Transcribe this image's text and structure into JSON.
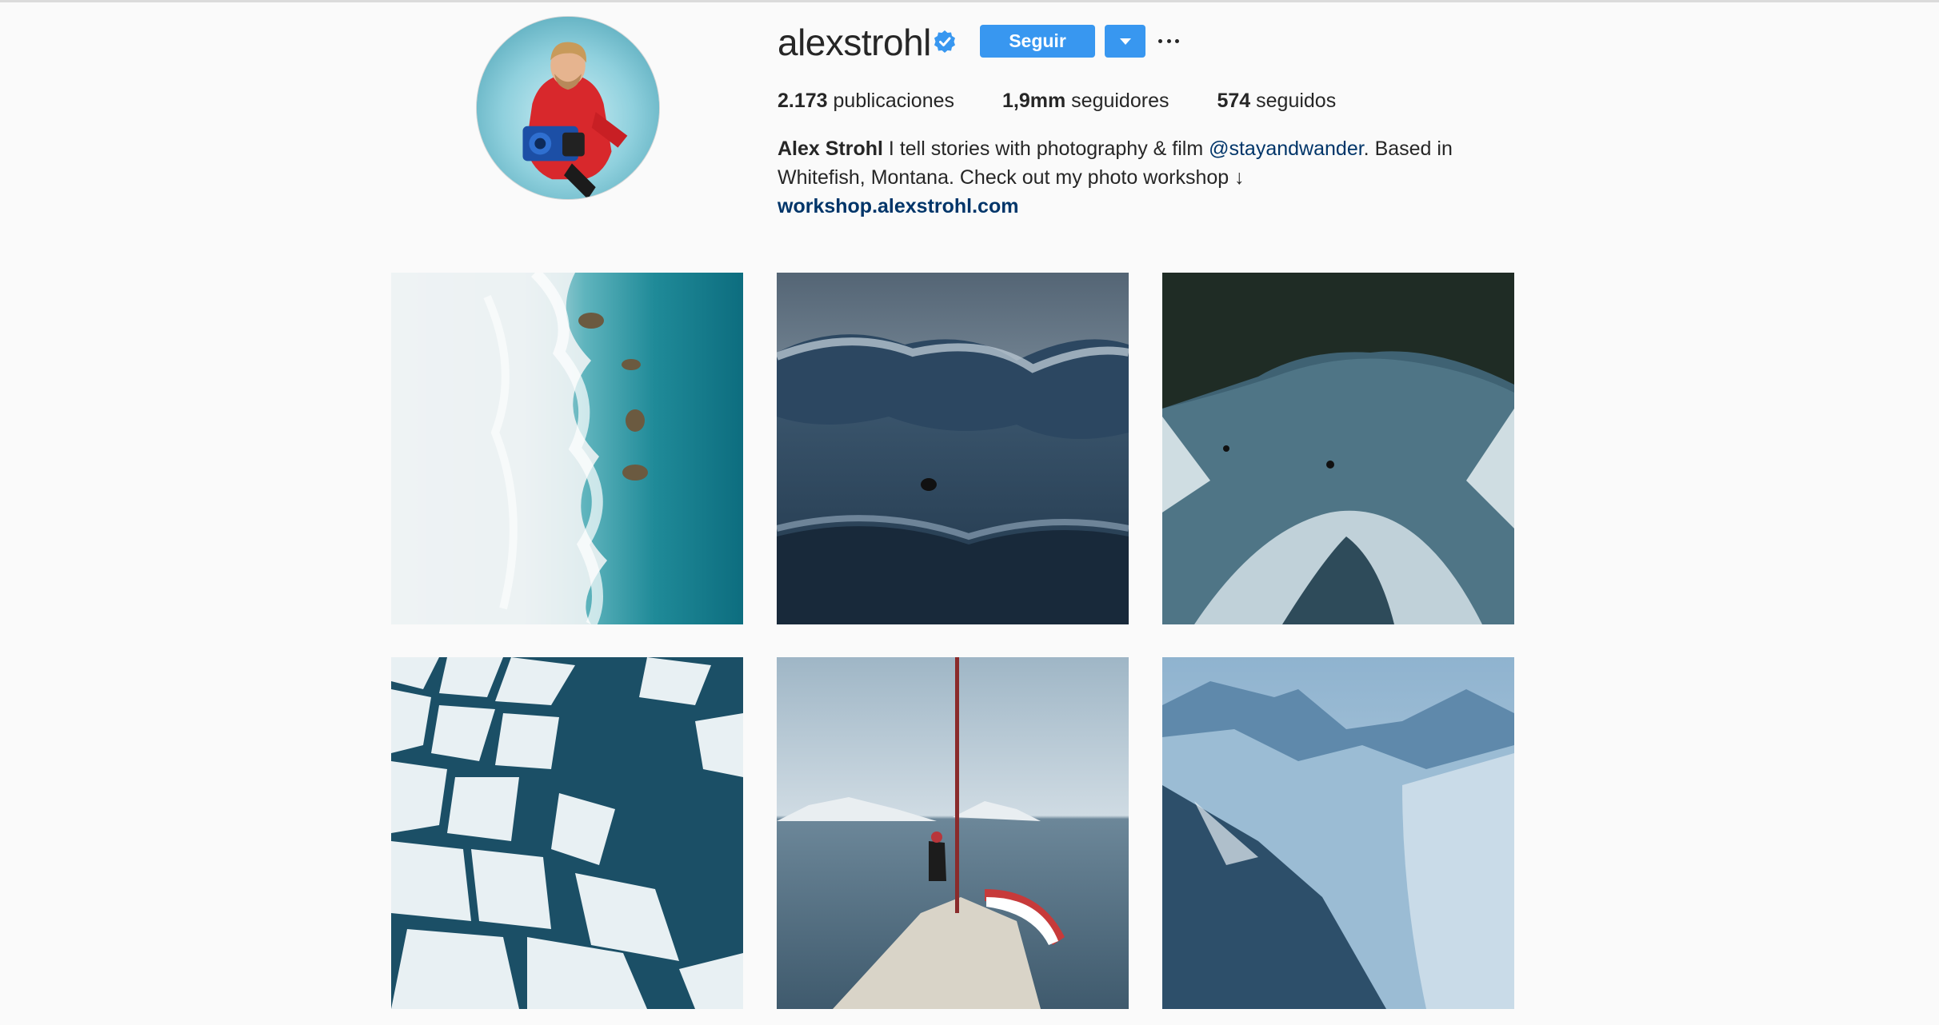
{
  "profile": {
    "username": "alexstrohl",
    "verified_icon": "verified-badge-icon",
    "follow_label": "Seguir",
    "stats": {
      "posts_count": "2.173",
      "posts_label": " publicaciones",
      "followers_count": "1,9mm",
      "followers_label": " seguidores",
      "following_count": "574",
      "following_label": " seguidos"
    },
    "bio": {
      "full_name": "Alex Strohl",
      "text_part1": " I tell stories with photography & film ",
      "mention": "@stayandwander",
      "text_part2": ". Based in Whitefish, Montana. Check out my photo workshop ↓",
      "website": "workshop.alexstrohl.com"
    }
  },
  "colors": {
    "accent": "#3897f0",
    "link": "#003569",
    "background": "#fafafa",
    "text": "#262626"
  },
  "posts": [
    {
      "name": "post-aerial-coast-waves"
    },
    {
      "name": "post-surfer-big-wave"
    },
    {
      "name": "post-river-surfing-forest"
    },
    {
      "name": "post-aerial-ice-floes"
    },
    {
      "name": "post-sailboat-bow-fjord"
    },
    {
      "name": "post-snowy-mountains"
    }
  ]
}
